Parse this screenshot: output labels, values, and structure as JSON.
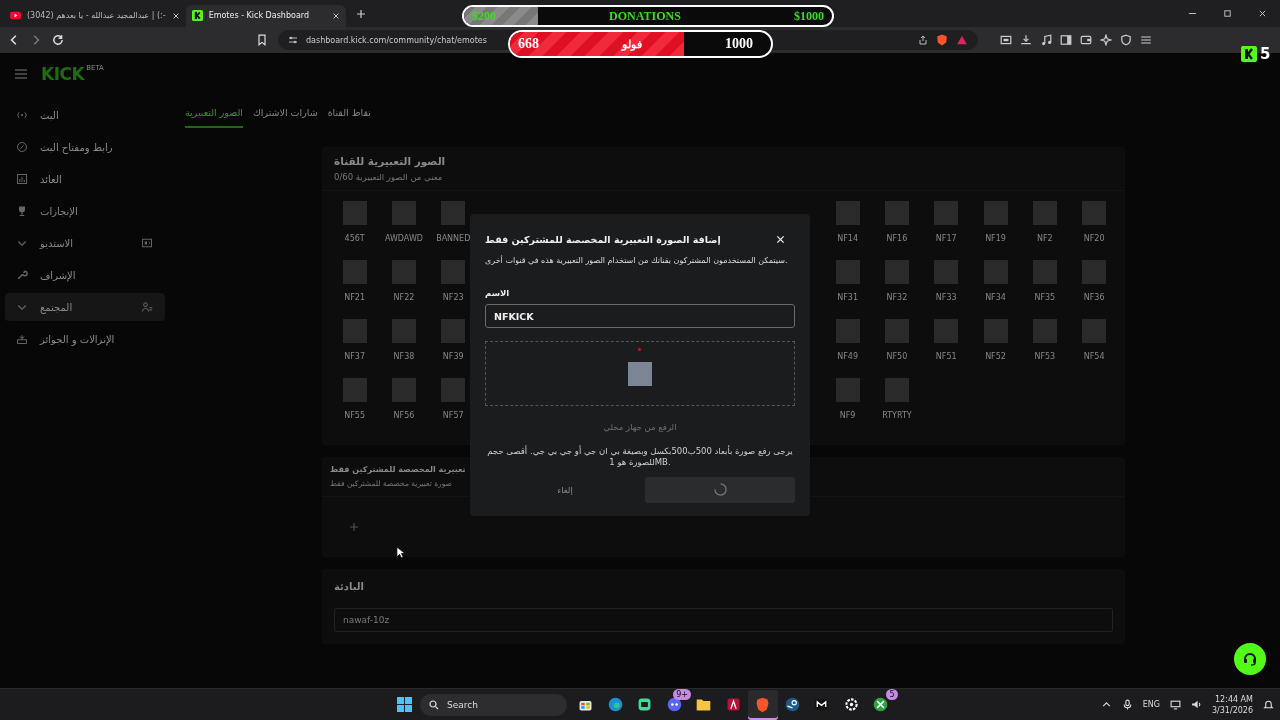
{
  "browser": {
    "tabs": [
      {
        "title": "Emotes - Kick Dashboard",
        "kind": "kick",
        "selected": true
      },
      {
        "title": "(3042) عبدالمجيد عبدالله - يا بعدهم | (:-",
        "kind": "youtube",
        "selected": false
      }
    ],
    "url": "dashboard.kick.com/community/chat/emotes"
  },
  "stream_overlay": {
    "donations": {
      "start": "$200",
      "title": "DONATIONS",
      "goal": "$1000",
      "level": 0.2
    },
    "followers": {
      "count": "668",
      "title": "فولو",
      "goal": "1000",
      "level": 0.668
    },
    "corner_count": "5"
  },
  "sidebar": {
    "logo": "KICK",
    "logo_badge": "BETA",
    "items": [
      {
        "label": "البث",
        "kind": "link",
        "selected": false
      },
      {
        "label": "رابط ومفتاح البث",
        "kind": "link",
        "selected": false
      },
      {
        "label": "العائد",
        "kind": "link",
        "selected": false
      },
      {
        "label": "الإنجازات",
        "kind": "link",
        "selected": false
      },
      {
        "label": "الاستديو",
        "kind": "group",
        "expanded": false,
        "selected": false
      },
      {
        "label": "الإشراف",
        "kind": "link",
        "selected": false
      },
      {
        "label": "المجتمع",
        "kind": "group",
        "expanded": false,
        "selected": true
      },
      {
        "label": "الإنزالات و الجوائز",
        "kind": "link",
        "selected": false
      }
    ]
  },
  "tabs": [
    {
      "label": "نقاط القناة",
      "selected": false
    },
    {
      "label": "شارات الاشتراك",
      "selected": false
    },
    {
      "label": "الصور التعبيرية",
      "selected": true
    }
  ],
  "channel_emotes": {
    "title": "الصور التعبيرية للقناة",
    "subtitle": "0/60 معني من الصور التعبيرية",
    "rows": [
      {
        "right": [
          "NF20",
          "NF2",
          "NF19",
          "NF17",
          "NF16",
          "NF14"
        ],
        "left": [
          "BANNED",
          "AWDAWD",
          "456T"
        ]
      },
      {
        "right": [
          "NF36",
          "NF35",
          "NF34",
          "NF33",
          "NF32",
          "NF31"
        ],
        "left": [
          "NF23",
          "NF22",
          "NF21"
        ]
      },
      {
        "right": [
          "NF54",
          "NF53",
          "NF52",
          "NF51",
          "NF50",
          "NF49"
        ],
        "left": [
          "NF39",
          "NF38",
          "NF37"
        ]
      },
      {
        "right": [
          "RTYRTY",
          "NF9"
        ],
        "left": [
          "NF57",
          "NF56",
          "NF55"
        ]
      }
    ]
  },
  "subscriber_emotes": {
    "title": "تعبيرية المخصصة للمشتركين فقط",
    "subtitle": "صورة تعبيرية مخصصة للمشتركين فقط"
  },
  "prefix": {
    "title": "البادئة",
    "value": "nawaf-10z"
  },
  "modal": {
    "title": "إضافة الصورة التعبيرية المخصصة للمشتركين فقط",
    "description": "سيتمكن المستخدمون المشتركون بقناتك من استخدام الصور التعبيرية هذه في قنوات أخرى.",
    "name_label": "الاسم",
    "name_value": "NFKICK",
    "upload": {
      "label": "الرفع من جهاز محلي",
      "disabled": true
    },
    "hint": "يرجى رفع صورة بأبعاد 500ب500بكسل وبصيغة بي ان جي أو جي بي جي. أقصى حجم للصورة هو 1MB.",
    "cancel": {
      "label": "إلغاء",
      "disabled": true
    },
    "submit": {
      "loading": true
    }
  },
  "taskbar": {
    "search": "Search",
    "apps": [
      {
        "kind": "xbox",
        "selected": false,
        "badge": "5"
      },
      {
        "kind": "gear",
        "selected": false
      },
      {
        "kind": "mail",
        "selected": false
      },
      {
        "kind": "steam",
        "selected": false
      },
      {
        "kind": "brave",
        "selected": true
      },
      {
        "kind": "app",
        "selected": false
      },
      {
        "kind": "folder",
        "selected": false
      },
      {
        "kind": "discord",
        "selected": false,
        "badge": "9+"
      },
      {
        "kind": "chat",
        "selected": false
      },
      {
        "kind": "edge",
        "selected": false
      },
      {
        "kind": "store",
        "selected": false
      }
    ],
    "language": "ENG",
    "time": "12:44 AM",
    "date": "3/31/2026"
  }
}
